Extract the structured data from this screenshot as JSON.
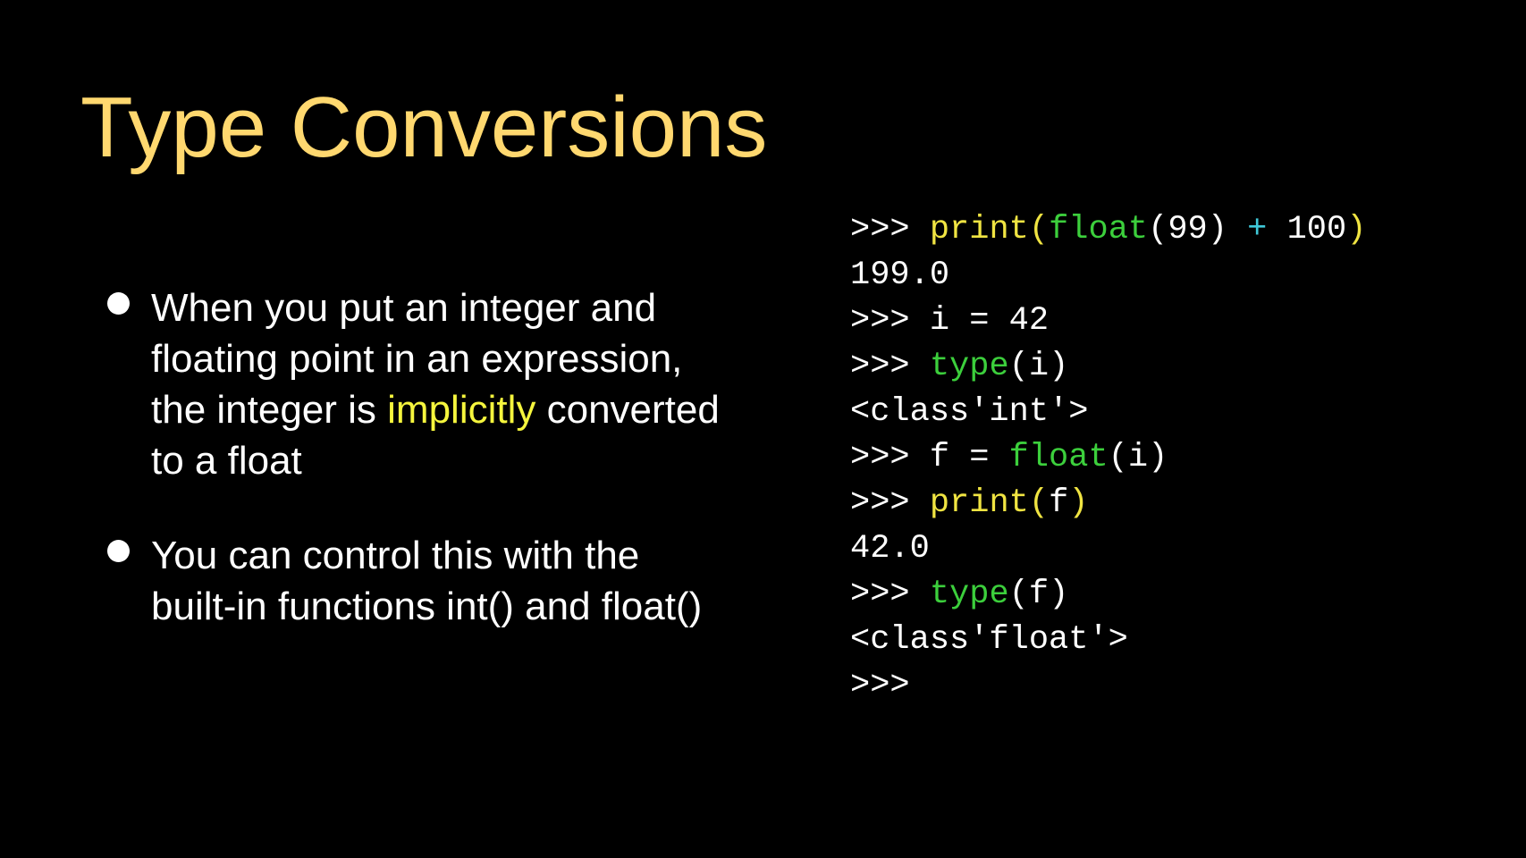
{
  "slide": {
    "title": "Type Conversions",
    "bullets": [
      {
        "parts": [
          {
            "text": "When you put an integer and floating point in an expression, the integer is ",
            "highlight": false
          },
          {
            "text": "implicitly",
            "highlight": true
          },
          {
            "text": " converted to a float",
            "highlight": false
          }
        ]
      },
      {
        "parts": [
          {
            "text": "You can control this with the built-in functions int() and float()",
            "highlight": false
          }
        ]
      }
    ],
    "colors": {
      "background": "#000000",
      "title": "#ffd86f",
      "body_text": "#ffffff",
      "highlight": "#f5f53d",
      "code_default": "#ffffff",
      "code_yellow": "#f0e442",
      "code_green": "#3ccf3c",
      "code_cyan": "#3fc8d8"
    }
  },
  "code_lines": [
    [
      {
        "text": ">>> ",
        "color": "white"
      },
      {
        "text": "print",
        "color": "yellow"
      },
      {
        "text": "(",
        "color": "yellow"
      },
      {
        "text": "float",
        "color": "green"
      },
      {
        "text": "(99) ",
        "color": "white"
      },
      {
        "text": "+",
        "color": "cyan"
      },
      {
        "text": " 100",
        "color": "white"
      },
      {
        "text": ")",
        "color": "yellow"
      }
    ],
    [
      {
        "text": "199.0",
        "color": "white"
      }
    ],
    [
      {
        "text": ">>> i = 42",
        "color": "white"
      }
    ],
    [
      {
        "text": ">>> ",
        "color": "white"
      },
      {
        "text": "type",
        "color": "green"
      },
      {
        "text": "(i)",
        "color": "white"
      }
    ],
    [
      {
        "text": "<class'int'>",
        "color": "white"
      }
    ],
    [
      {
        "text": ">>> f = ",
        "color": "white"
      },
      {
        "text": "float",
        "color": "green"
      },
      {
        "text": "(i)",
        "color": "white"
      }
    ],
    [
      {
        "text": ">>> ",
        "color": "white"
      },
      {
        "text": "print",
        "color": "yellow"
      },
      {
        "text": "(",
        "color": "yellow"
      },
      {
        "text": "f",
        "color": "white"
      },
      {
        "text": ")",
        "color": "yellow"
      }
    ],
    [
      {
        "text": "42.0",
        "color": "white"
      }
    ],
    [
      {
        "text": ">>> ",
        "color": "white"
      },
      {
        "text": "type",
        "color": "green"
      },
      {
        "text": "(f)",
        "color": "white"
      }
    ],
    [
      {
        "text": "<class'float'>",
        "color": "white"
      }
    ],
    [
      {
        "text": ">>>",
        "color": "white"
      }
    ]
  ]
}
